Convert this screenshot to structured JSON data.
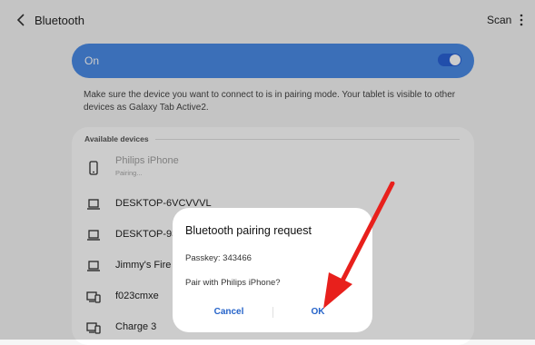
{
  "header": {
    "title": "Bluetooth",
    "scan_label": "Scan"
  },
  "toggle": {
    "label": "On",
    "state": "on"
  },
  "info_text": "Make sure the device you want to connect to is in pairing mode. Your tablet is visible to other devices as Galaxy Tab Active2.",
  "available_devices": {
    "header": "Available devices",
    "items": [
      {
        "name": "Philips iPhone",
        "status": "Pairing...",
        "icon": "phone-icon"
      },
      {
        "name": "DESKTOP-6VCVVVL",
        "icon": "laptop-icon"
      },
      {
        "name": "DESKTOP-93",
        "icon": "laptop-icon"
      },
      {
        "name": "Jimmy's Fire",
        "icon": "laptop-icon"
      },
      {
        "name": "f023cmxe",
        "icon": "desktop-phone-icon"
      },
      {
        "name": "Charge 3",
        "icon": "desktop-phone-icon"
      }
    ]
  },
  "dialog": {
    "title": "Bluetooth pairing request",
    "passkey": "Passkey: 343466",
    "question": "Pair with Philips iPhone?",
    "cancel_label": "Cancel",
    "ok_label": "OK"
  },
  "colors": {
    "accent": "#4a8be6",
    "button_text": "#2563c9",
    "annotation_arrow": "#e8201c"
  }
}
